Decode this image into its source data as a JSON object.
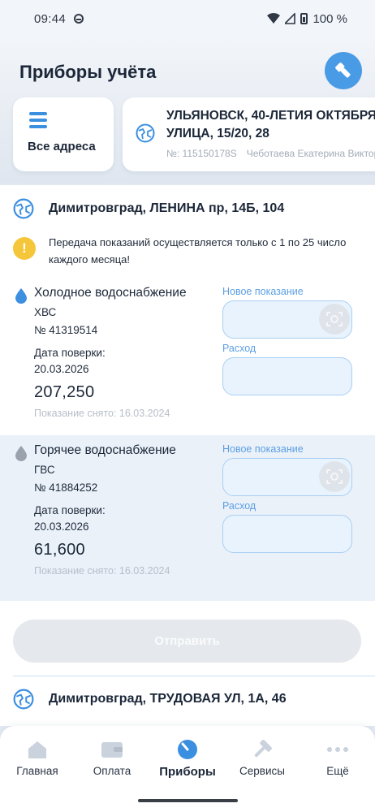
{
  "status": {
    "time": "09:44",
    "battery": "100 %"
  },
  "header": {
    "title": "Приборы учёта"
  },
  "address_switcher": {
    "all_label": "Все адреса",
    "selected": {
      "line1": "УЛЬЯНОВСК, 40-ЛЕТИЯ ОКТЯБРЯ",
      "line2": "УЛИЦА, 15/20, 28",
      "account": "№: 115150178S",
      "owner": "Чеботаева Екатерина Викторовна"
    }
  },
  "section1": {
    "address": "Димитровград, ЛЕНИНА пр, 14Б, 104",
    "notice": "Передача показаний осуществляется только с 1 по 25 число каждого месяца!",
    "meters": [
      {
        "name": "Холодное водоснабжение",
        "type": "ХВС",
        "number": "№ 41319514",
        "verify_label": "Дата поверки:",
        "verify_date": "20.03.2026",
        "reading": "207,250",
        "taken": "Показание снято: 16.03.2024",
        "new_label": "Новое показание",
        "usage_label": "Расход",
        "drop_color": "#3d8fe0"
      },
      {
        "name": "Горячее водоснабжение",
        "type": "ГВС",
        "number": "№ 41884252",
        "verify_label": "Дата поверки:",
        "verify_date": "20.03.2026",
        "reading": "61,600",
        "taken": "Показание снято: 16.03.2024",
        "new_label": "Новое показание",
        "usage_label": "Расход",
        "drop_color": "#9aa3ad"
      }
    ],
    "submit_label": "Отправить"
  },
  "section2": {
    "address": "Димитровград, ТРУДОВАЯ УЛ, 1А, 46"
  },
  "tabs": [
    {
      "label": "Главная",
      "icon": "home-icon"
    },
    {
      "label": "Оплата",
      "icon": "wallet-icon"
    },
    {
      "label": "Приборы",
      "icon": "meter-icon",
      "active": true
    },
    {
      "label": "Сервисы",
      "icon": "hammer-icon"
    },
    {
      "label": "Ещё",
      "icon": "more-icon"
    }
  ],
  "colors": {
    "accent": "#3b8fe0",
    "warning": "#f6c63a",
    "field_border": "#a9cff3"
  }
}
